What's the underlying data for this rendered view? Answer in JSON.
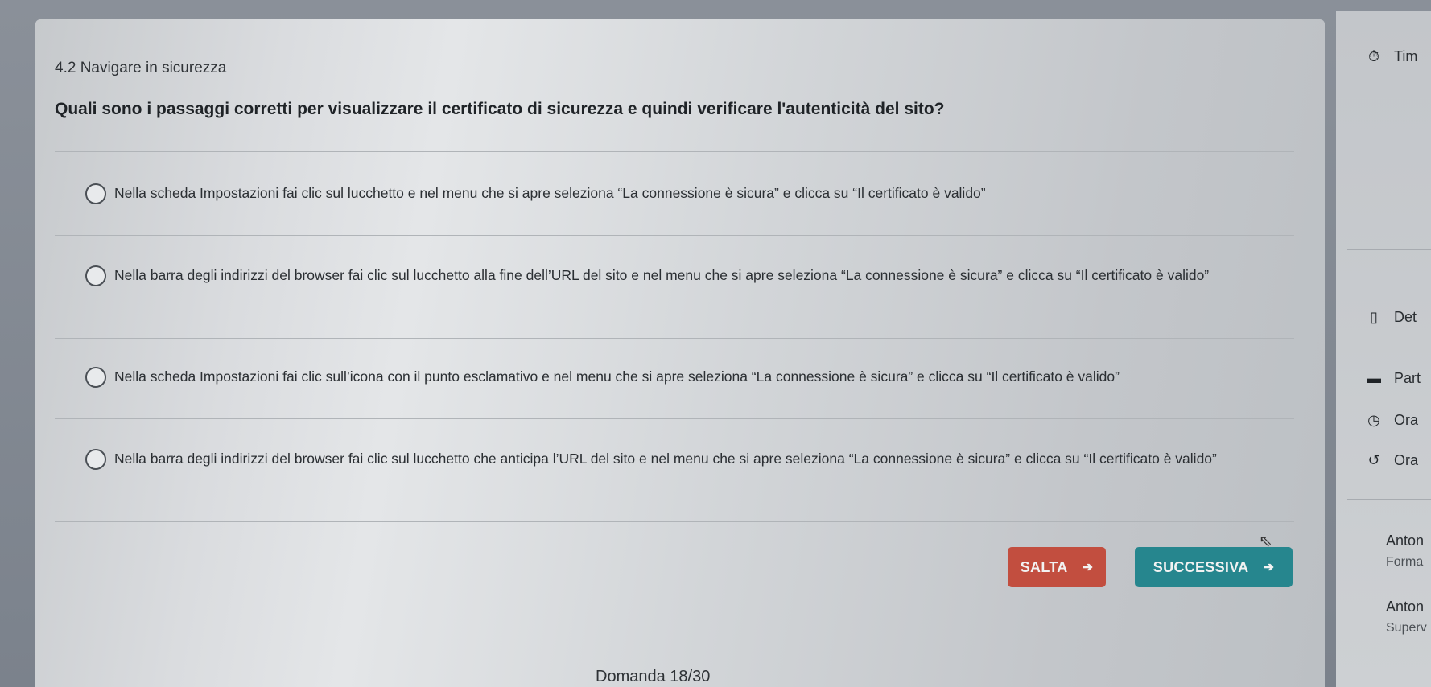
{
  "header": {
    "section_title": "4.2 Navigare in sicurezza",
    "question": "Quali sono i passaggi corretti per visualizzare il certificato di sicurezza e quindi verificare l'autenticità del sito?"
  },
  "answers": [
    {
      "text": "Nella scheda Impostazioni fai clic sul lucchetto e nel menu che si apre seleziona “La connessione è sicura” e clicca su “Il certificato è valido”"
    },
    {
      "text": "Nella barra degli indirizzi del browser fai clic sul lucchetto alla fine dell’URL del sito e nel menu che si apre seleziona “La connessione è sicura” e clicca su “Il certificato è valido”"
    },
    {
      "text": "Nella scheda Impostazioni fai clic sull’icona con il punto esclamativo e nel menu che si apre seleziona “La connessione è sicura” e clicca su “Il certificato è valido”"
    },
    {
      "text": "Nella barra degli indirizzi del browser fai clic sul lucchetto che anticipa l’URL del sito e nel menu che si apre seleziona “La connessione è sicura” e clicca su “Il certificato è valido”"
    }
  ],
  "buttons": {
    "skip_label": "SALTA",
    "next_label": "SUCCESSIVA",
    "skip_color": "#c24e3f",
    "next_color": "#26868e"
  },
  "footer": {
    "progress": "Domanda 18/30"
  },
  "sidebar": {
    "timer_label": "Tim",
    "details_label": "Det",
    "items": [
      {
        "icon": "briefcase-icon",
        "label": "Part"
      },
      {
        "icon": "clock-icon",
        "label": "Ora"
      },
      {
        "icon": "history-icon",
        "label": "Ora"
      }
    ],
    "person1_name": "Anton",
    "person1_role": "Forma",
    "person2_name": "Anton",
    "person2_role": "Superv"
  }
}
